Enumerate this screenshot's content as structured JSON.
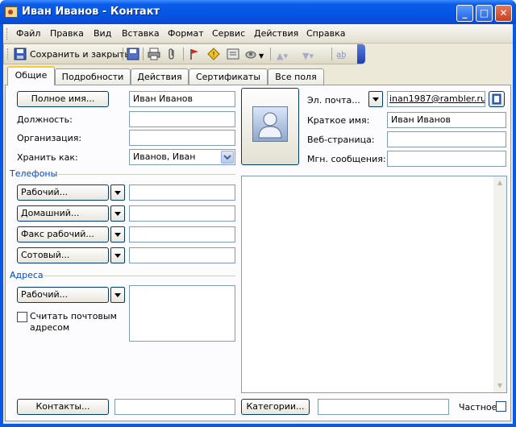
{
  "window": {
    "title": "Иван Иванов - Контакт",
    "min": "_",
    "max": "□",
    "close": "✕"
  },
  "menu": [
    "Файл",
    "Правка",
    "Вид",
    "Вставка",
    "Формат",
    "Сервис",
    "Действия",
    "Справка"
  ],
  "toolbar": {
    "save_close": "Сохранить и закрыть"
  },
  "tabs": [
    "Общие",
    "Подробности",
    "Действия",
    "Сертификаты",
    "Все поля"
  ],
  "general": {
    "full_name_button": "Полное имя...",
    "full_name_value": "Иван Иванов",
    "position_label": "Должность:",
    "position_value": "",
    "organization_label": "Организация:",
    "organization_value": "",
    "file_as_label": "Хранить как:",
    "file_as_value": "Иванов, Иван",
    "phones_section": "Телефоны",
    "phones": [
      {
        "label": "Рабочий...",
        "value": ""
      },
      {
        "label": "Домашний...",
        "value": ""
      },
      {
        "label": "Факс рабочий...",
        "value": ""
      },
      {
        "label": "Сотовый...",
        "value": ""
      }
    ],
    "address_section": "Адреса",
    "address_button": "Рабочий...",
    "address_value": "",
    "mailing_label_1": "Считать почтовым",
    "mailing_label_2": "адресом",
    "email_label": "Эл. почта...",
    "email_value": "inan1987@rambler.ru",
    "display_as_label": "Краткое имя:",
    "display_as_value": "Иван Иванов",
    "web_label": "Веб-страница:",
    "web_value": "",
    "im_label": "Мгн. сообщения:",
    "im_value": "",
    "contacts_button": "Контакты...",
    "contacts_value": "",
    "categories_button": "Категории...",
    "categories_value": "",
    "private_label": "Частное"
  }
}
